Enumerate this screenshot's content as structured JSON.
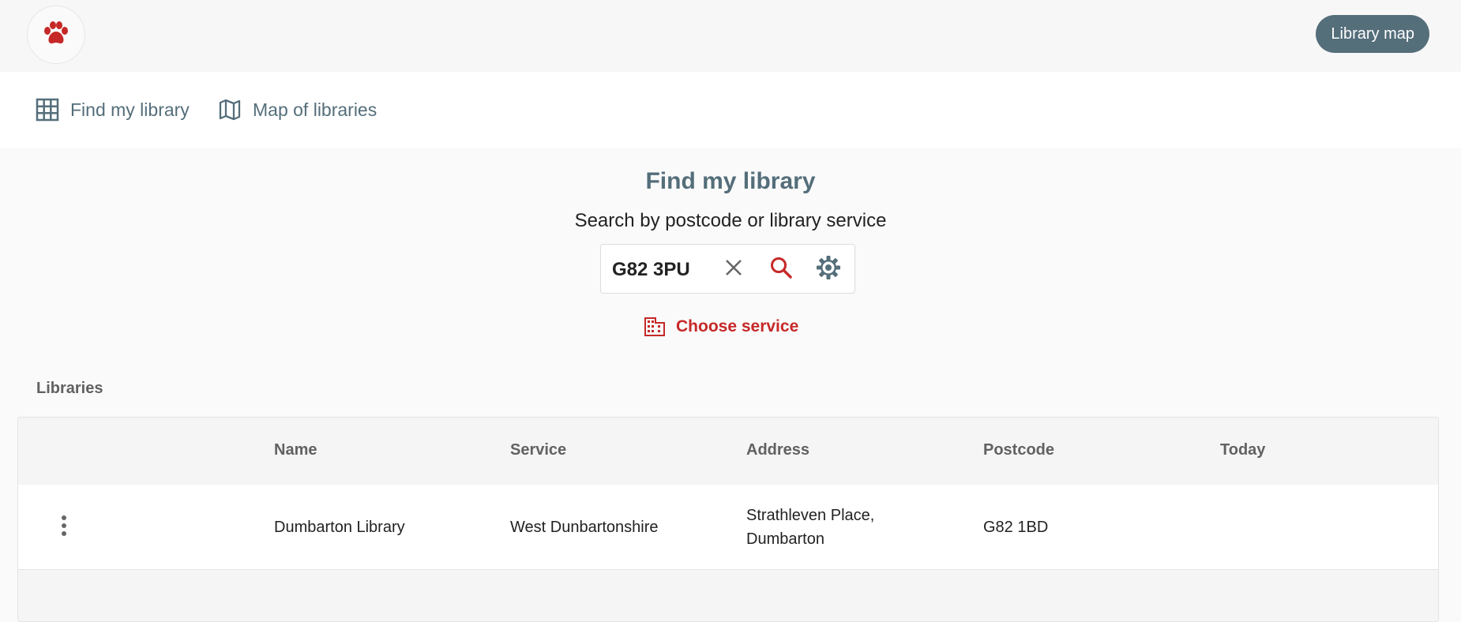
{
  "header": {
    "logo_icon": "paw-icon",
    "library_map_button": "Library map"
  },
  "nav": {
    "items": [
      {
        "label": "Find my library",
        "icon": "grid-icon"
      },
      {
        "label": "Map of libraries",
        "icon": "map-icon"
      }
    ]
  },
  "search": {
    "title": "Find my library",
    "subtitle": "Search by postcode or library service",
    "value": "G82 3PU",
    "clear_icon": "close-icon",
    "search_icon": "search-icon",
    "settings_icon": "gear-icon",
    "choose_service": "Choose service"
  },
  "libraries": {
    "section_label": "Libraries",
    "columns": [
      "Name",
      "Service",
      "Address",
      "Postcode",
      "Today"
    ],
    "rows": [
      {
        "name": "Dumbarton Library",
        "service": "West Dunbartonshire",
        "address_line1": "Strathleven Place,",
        "address_line2": "Dumbarton",
        "postcode": "G82 1BD",
        "today": ""
      }
    ]
  },
  "colors": {
    "accent": "#c62828",
    "primary": "#546e7a",
    "background": "#fafafa"
  }
}
